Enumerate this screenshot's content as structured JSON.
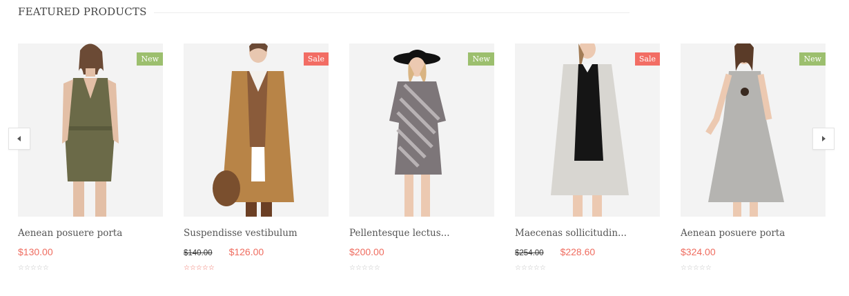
{
  "section": {
    "title": "FEATURED PRODUCTS"
  },
  "colors": {
    "accent": "#ef6c5f",
    "new_badge": "#9cbf6e",
    "sale_badge": "#f26d64",
    "star_muted": "#bdbdbd"
  },
  "nav": {
    "prev_icon": "caret-left-icon",
    "next_icon": "caret-right-icon"
  },
  "products": [
    {
      "name": "Aenean posuere porta",
      "badge": "New",
      "old_price": "",
      "price": "$130.00",
      "rating": 0,
      "stars": "☆☆☆☆☆",
      "image": "woman-olive-romper"
    },
    {
      "name": "Suspendisse vestibulum",
      "badge": "Sale",
      "old_price": "$140.00",
      "price": "$126.00",
      "rating": 0,
      "stars": "☆☆☆☆☆",
      "image": "man-camel-coat-hat"
    },
    {
      "name": "Pellentesque lectus...",
      "badge": "New",
      "old_price": "",
      "price": "$200.00",
      "rating": 0,
      "stars": "☆☆☆☆☆",
      "image": "woman-striped-dress-black-hat"
    },
    {
      "name": "Maecenas sollicitudin...",
      "badge": "Sale",
      "old_price": "$254.00",
      "price": "$228.60",
      "rating": 0,
      "stars": "☆☆☆☆☆",
      "image": "woman-grey-long-coat"
    },
    {
      "name": "Aenean posuere porta",
      "badge": "New",
      "old_price": "",
      "price": "$324.00",
      "rating": 0,
      "stars": "☆☆☆☆☆",
      "image": "woman-grey-midi-dress"
    }
  ]
}
